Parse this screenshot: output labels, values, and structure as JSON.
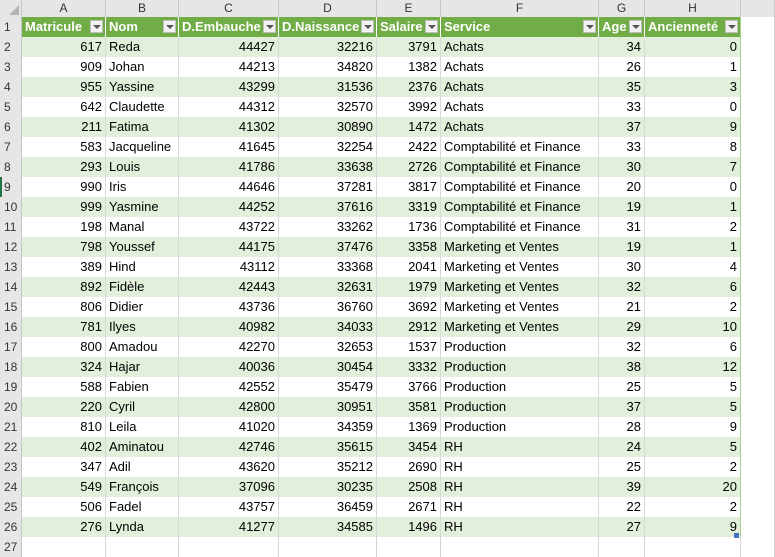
{
  "columns": [
    "A",
    "B",
    "C",
    "D",
    "E",
    "F",
    "G",
    "H"
  ],
  "table": {
    "headers": [
      "Matricule",
      "Nom",
      "D.Embauche",
      "D.Naissance",
      "Salaire",
      "Service",
      "Age",
      "Ancienneté"
    ],
    "rows": [
      {
        "row": "2",
        "cells": [
          "617",
          "Reda",
          "44427",
          "32216",
          "3791",
          "Achats",
          "34",
          "0"
        ]
      },
      {
        "row": "3",
        "cells": [
          "909",
          "Johan",
          "44213",
          "34820",
          "1382",
          "Achats",
          "26",
          "1"
        ]
      },
      {
        "row": "4",
        "cells": [
          "955",
          "Yassine",
          "43299",
          "31536",
          "2376",
          "Achats",
          "35",
          "3"
        ]
      },
      {
        "row": "5",
        "cells": [
          "642",
          "Claudette",
          "44312",
          "32570",
          "3992",
          "Achats",
          "33",
          "0"
        ]
      },
      {
        "row": "6",
        "cells": [
          "211",
          "Fatima",
          "41302",
          "30890",
          "1472",
          "Achats",
          "37",
          "9"
        ]
      },
      {
        "row": "7",
        "cells": [
          "583",
          "Jacqueline",
          "41645",
          "32254",
          "2422",
          "Comptabilité et Finance",
          "33",
          "8"
        ]
      },
      {
        "row": "8",
        "cells": [
          "293",
          "Louis",
          "41786",
          "33638",
          "2726",
          "Comptabilité et Finance",
          "30",
          "7"
        ]
      },
      {
        "row": "9",
        "cells": [
          "990",
          "Iris",
          "44646",
          "37281",
          "3817",
          "Comptabilité et Finance",
          "20",
          "0"
        ]
      },
      {
        "row": "10",
        "cells": [
          "999",
          "Yasmine",
          "44252",
          "37616",
          "3319",
          "Comptabilité et Finance",
          "19",
          "1"
        ]
      },
      {
        "row": "11",
        "cells": [
          "198",
          "Manal",
          "43722",
          "33262",
          "1736",
          "Comptabilité et Finance",
          "31",
          "2"
        ]
      },
      {
        "row": "12",
        "cells": [
          "798",
          "Youssef",
          "44175",
          "37476",
          "3358",
          "Marketing et Ventes",
          "19",
          "1"
        ]
      },
      {
        "row": "13",
        "cells": [
          "389",
          "Hind",
          "43112",
          "33368",
          "2041",
          "Marketing et Ventes",
          "30",
          "4"
        ]
      },
      {
        "row": "14",
        "cells": [
          "892",
          "Fidèle",
          "42443",
          "32631",
          "1979",
          "Marketing et Ventes",
          "32",
          "6"
        ]
      },
      {
        "row": "15",
        "cells": [
          "806",
          "Didier",
          "43736",
          "36760",
          "3692",
          "Marketing et Ventes",
          "21",
          "2"
        ]
      },
      {
        "row": "16",
        "cells": [
          "781",
          "Ilyes",
          "40982",
          "34033",
          "2912",
          "Marketing et Ventes",
          "29",
          "10"
        ]
      },
      {
        "row": "17",
        "cells": [
          "800",
          "Amadou",
          "42270",
          "32653",
          "1537",
          "Production",
          "32",
          "6"
        ]
      },
      {
        "row": "18",
        "cells": [
          "324",
          "Hajar",
          "40036",
          "30454",
          "3332",
          "Production",
          "38",
          "12"
        ]
      },
      {
        "row": "19",
        "cells": [
          "588",
          "Fabien",
          "42552",
          "35479",
          "3766",
          "Production",
          "25",
          "5"
        ]
      },
      {
        "row": "20",
        "cells": [
          "220",
          "Cyril",
          "42800",
          "30951",
          "3581",
          "Production",
          "37",
          "5"
        ]
      },
      {
        "row": "21",
        "cells": [
          "810",
          "Leila",
          "41020",
          "34359",
          "1369",
          "Production",
          "28",
          "9"
        ]
      },
      {
        "row": "22",
        "cells": [
          "402",
          "Aminatou",
          "42746",
          "35615",
          "3454",
          "RH",
          "24",
          "5"
        ]
      },
      {
        "row": "23",
        "cells": [
          "347",
          "Adil",
          "43620",
          "35212",
          "2690",
          "RH",
          "25",
          "2"
        ]
      },
      {
        "row": "24",
        "cells": [
          "549",
          "François",
          "37096",
          "30235",
          "2508",
          "RH",
          "39",
          "20"
        ]
      },
      {
        "row": "25",
        "cells": [
          "506",
          "Fadel",
          "43757",
          "36459",
          "2671",
          "RH",
          "22",
          "2"
        ]
      },
      {
        "row": "26",
        "cells": [
          "276",
          "Lynda",
          "41277",
          "34585",
          "1496",
          "RH",
          "27",
          "9"
        ]
      }
    ]
  },
  "header_row_number": "1",
  "empty_row_number": "27",
  "active_row": "9",
  "colors": {
    "header_bg": "#70ad47",
    "band_bg": "#e2efda",
    "border": "#a9d08e"
  }
}
